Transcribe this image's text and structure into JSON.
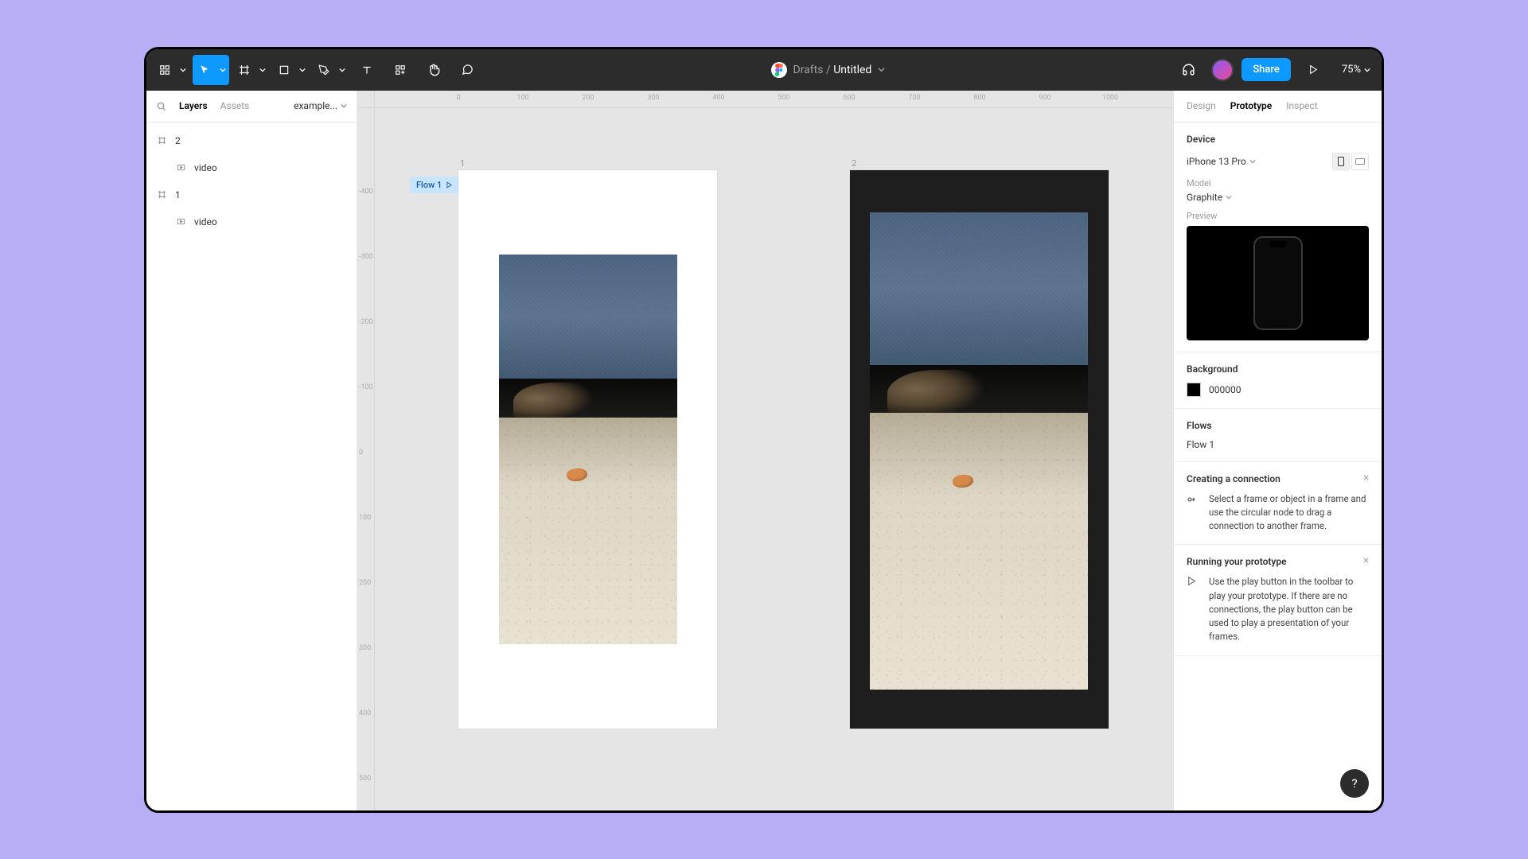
{
  "toolbar": {
    "share_label": "Share",
    "zoom": "75%"
  },
  "breadcrumb": {
    "folder": "Drafts",
    "separator": "/",
    "file": "Untitled"
  },
  "left_panel": {
    "tabs": {
      "layers": "Layers",
      "assets": "Assets"
    },
    "page": "example...",
    "layers": [
      {
        "name": "2",
        "type": "frame"
      },
      {
        "name": "video",
        "type": "video",
        "child": true
      },
      {
        "name": "1",
        "type": "frame"
      },
      {
        "name": "video",
        "type": "video",
        "child": true
      }
    ]
  },
  "canvas": {
    "ruler_h": [
      "0",
      "100",
      "200",
      "300",
      "400",
      "500",
      "600",
      "700",
      "800",
      "900",
      "1000"
    ],
    "ruler_v": [
      "-400",
      "-300",
      "-200",
      "-100",
      "0",
      "100",
      "200",
      "300",
      "400",
      "500"
    ],
    "frame1_label": "1",
    "frame2_label": "2",
    "flow_pill": "Flow 1"
  },
  "right_panel": {
    "tabs": {
      "design": "Design",
      "prototype": "Prototype",
      "inspect": "Inspect"
    },
    "device": {
      "title": "Device",
      "name": "iPhone 13 Pro",
      "model_label": "Model",
      "model_value": "Graphite",
      "preview_label": "Preview"
    },
    "background": {
      "title": "Background",
      "hex": "000000"
    },
    "flows": {
      "title": "Flows",
      "items": [
        "Flow 1"
      ]
    },
    "hints": [
      {
        "title": "Creating a connection",
        "body": "Select a frame or object in a frame and use the circular node to drag a connection to another frame."
      },
      {
        "title": "Running your prototype",
        "body": "Use the play button in the toolbar to play your prototype. If there are no connections, the play button can be used to play a presentation of your frames."
      }
    ],
    "help": "?"
  }
}
